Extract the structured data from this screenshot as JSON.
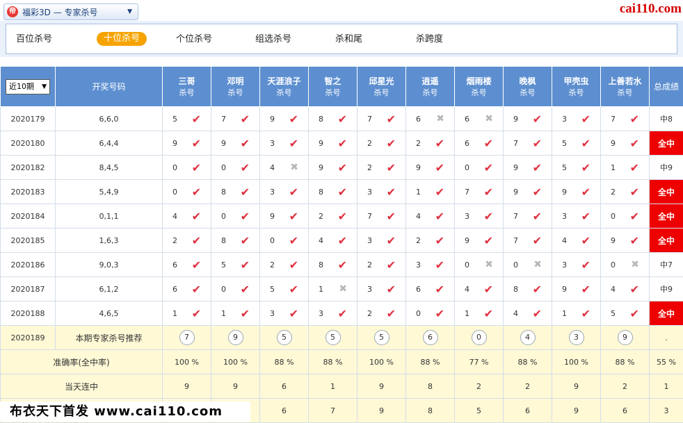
{
  "selector": {
    "icon_text": "帝",
    "label": "福彩3D — 专家杀号"
  },
  "watermark_top": "cai110.com",
  "tabs": [
    "百位杀号",
    "十位杀号",
    "个位杀号",
    "组选杀号",
    "杀和尾",
    "杀跨度"
  ],
  "active_tab": 1,
  "header": {
    "period_select": "近10期",
    "draw_col": "开奖号码",
    "total_col": "总成绩",
    "experts": [
      {
        "name": "三哥",
        "sub": "杀号"
      },
      {
        "name": "邓明",
        "sub": "杀号"
      },
      {
        "name": "天涯浪子",
        "sub": "杀号"
      },
      {
        "name": "智之",
        "sub": "杀号"
      },
      {
        "name": "邱星光",
        "sub": "杀号"
      },
      {
        "name": "逍遥",
        "sub": "杀号"
      },
      {
        "name": "烟雨楼",
        "sub": "杀号"
      },
      {
        "name": "晚枫",
        "sub": "杀号"
      },
      {
        "name": "甲壳虫",
        "sub": "杀号"
      },
      {
        "name": "上善若水",
        "sub": "杀号"
      }
    ]
  },
  "rows": [
    {
      "period": "2020179",
      "draw": "6,6,0",
      "kills": [
        [
          "5",
          1
        ],
        [
          "7",
          1
        ],
        [
          "9",
          1
        ],
        [
          "8",
          1
        ],
        [
          "7",
          1
        ],
        [
          "6",
          0
        ],
        [
          "6",
          0
        ],
        [
          "9",
          1
        ],
        [
          "3",
          1
        ],
        [
          "7",
          1
        ]
      ],
      "total": "中8",
      "all_hit": false
    },
    {
      "period": "2020180",
      "draw": "6,4,4",
      "kills": [
        [
          "9",
          1
        ],
        [
          "9",
          1
        ],
        [
          "3",
          1
        ],
        [
          "9",
          1
        ],
        [
          "2",
          1
        ],
        [
          "2",
          1
        ],
        [
          "6",
          1
        ],
        [
          "7",
          1
        ],
        [
          "5",
          1
        ],
        [
          "9",
          1
        ]
      ],
      "total": "全中",
      "all_hit": true
    },
    {
      "period": "2020182",
      "draw": "8,4,5",
      "kills": [
        [
          "0",
          1
        ],
        [
          "0",
          1
        ],
        [
          "4",
          0
        ],
        [
          "9",
          1
        ],
        [
          "2",
          1
        ],
        [
          "9",
          1
        ],
        [
          "0",
          1
        ],
        [
          "9",
          1
        ],
        [
          "5",
          1
        ],
        [
          "1",
          1
        ]
      ],
      "total": "中9",
      "all_hit": false
    },
    {
      "period": "2020183",
      "draw": "5,4,9",
      "kills": [
        [
          "0",
          1
        ],
        [
          "8",
          1
        ],
        [
          "3",
          1
        ],
        [
          "8",
          1
        ],
        [
          "3",
          1
        ],
        [
          "1",
          1
        ],
        [
          "7",
          1
        ],
        [
          "9",
          1
        ],
        [
          "9",
          1
        ],
        [
          "2",
          1
        ]
      ],
      "total": "全中",
      "all_hit": true
    },
    {
      "period": "2020184",
      "draw": "0,1,1",
      "kills": [
        [
          "4",
          1
        ],
        [
          "0",
          1
        ],
        [
          "9",
          1
        ],
        [
          "2",
          1
        ],
        [
          "7",
          1
        ],
        [
          "4",
          1
        ],
        [
          "3",
          1
        ],
        [
          "7",
          1
        ],
        [
          "3",
          1
        ],
        [
          "0",
          1
        ]
      ],
      "total": "全中",
      "all_hit": true
    },
    {
      "period": "2020185",
      "draw": "1,6,3",
      "kills": [
        [
          "2",
          1
        ],
        [
          "8",
          1
        ],
        [
          "0",
          1
        ],
        [
          "4",
          1
        ],
        [
          "3",
          1
        ],
        [
          "2",
          1
        ],
        [
          "9",
          1
        ],
        [
          "7",
          1
        ],
        [
          "4",
          1
        ],
        [
          "9",
          1
        ]
      ],
      "total": "全中",
      "all_hit": true
    },
    {
      "period": "2020186",
      "draw": "9,0,3",
      "kills": [
        [
          "6",
          1
        ],
        [
          "5",
          1
        ],
        [
          "2",
          1
        ],
        [
          "8",
          1
        ],
        [
          "2",
          1
        ],
        [
          "3",
          1
        ],
        [
          "0",
          0
        ],
        [
          "0",
          0
        ],
        [
          "3",
          1
        ],
        [
          "0",
          0
        ]
      ],
      "total": "中7",
      "all_hit": false
    },
    {
      "period": "2020187",
      "draw": "6,1,2",
      "kills": [
        [
          "6",
          1
        ],
        [
          "0",
          1
        ],
        [
          "5",
          1
        ],
        [
          "1",
          0
        ],
        [
          "3",
          1
        ],
        [
          "6",
          1
        ],
        [
          "4",
          1
        ],
        [
          "8",
          1
        ],
        [
          "9",
          1
        ],
        [
          "4",
          1
        ]
      ],
      "total": "中9",
      "all_hit": false
    },
    {
      "period": "2020188",
      "draw": "4,6,5",
      "kills": [
        [
          "1",
          1
        ],
        [
          "1",
          1
        ],
        [
          "3",
          1
        ],
        [
          "3",
          1
        ],
        [
          "2",
          1
        ],
        [
          "0",
          1
        ],
        [
          "1",
          1
        ],
        [
          "4",
          1
        ],
        [
          "1",
          1
        ],
        [
          "5",
          1
        ]
      ],
      "total": "全中",
      "all_hit": true
    }
  ],
  "recommend": {
    "period": "2020189",
    "label": "本期专家杀号推荐",
    "numbers": [
      "7",
      "9",
      "5",
      "5",
      "5",
      "6",
      "0",
      "4",
      "3",
      "9"
    ],
    "total": "."
  },
  "accuracy": {
    "label": "准确率(全中率)",
    "values": [
      "100 %",
      "100 %",
      "88 %",
      "88 %",
      "100 %",
      "88 %",
      "77 %",
      "88 %",
      "100 %",
      "88 %"
    ],
    "total": "55 %"
  },
  "streak": {
    "label": "当天连中",
    "values": [
      "9",
      "9",
      "6",
      "1",
      "9",
      "8",
      "2",
      "2",
      "9",
      "2"
    ],
    "total": "1"
  },
  "last_row": {
    "values": [
      "",
      "",
      "6",
      "7",
      "9",
      "8",
      "5",
      "6",
      "9",
      "6"
    ],
    "total": "3"
  },
  "footer_watermark": "布衣天下首发 www.cai110.com",
  "colors": {
    "header_bg": "#5d8fd0",
    "hit_bg": "#ee0000",
    "active_tab": "#f6a300",
    "check": "#e03040",
    "yellow_row": "#fff9d6"
  }
}
